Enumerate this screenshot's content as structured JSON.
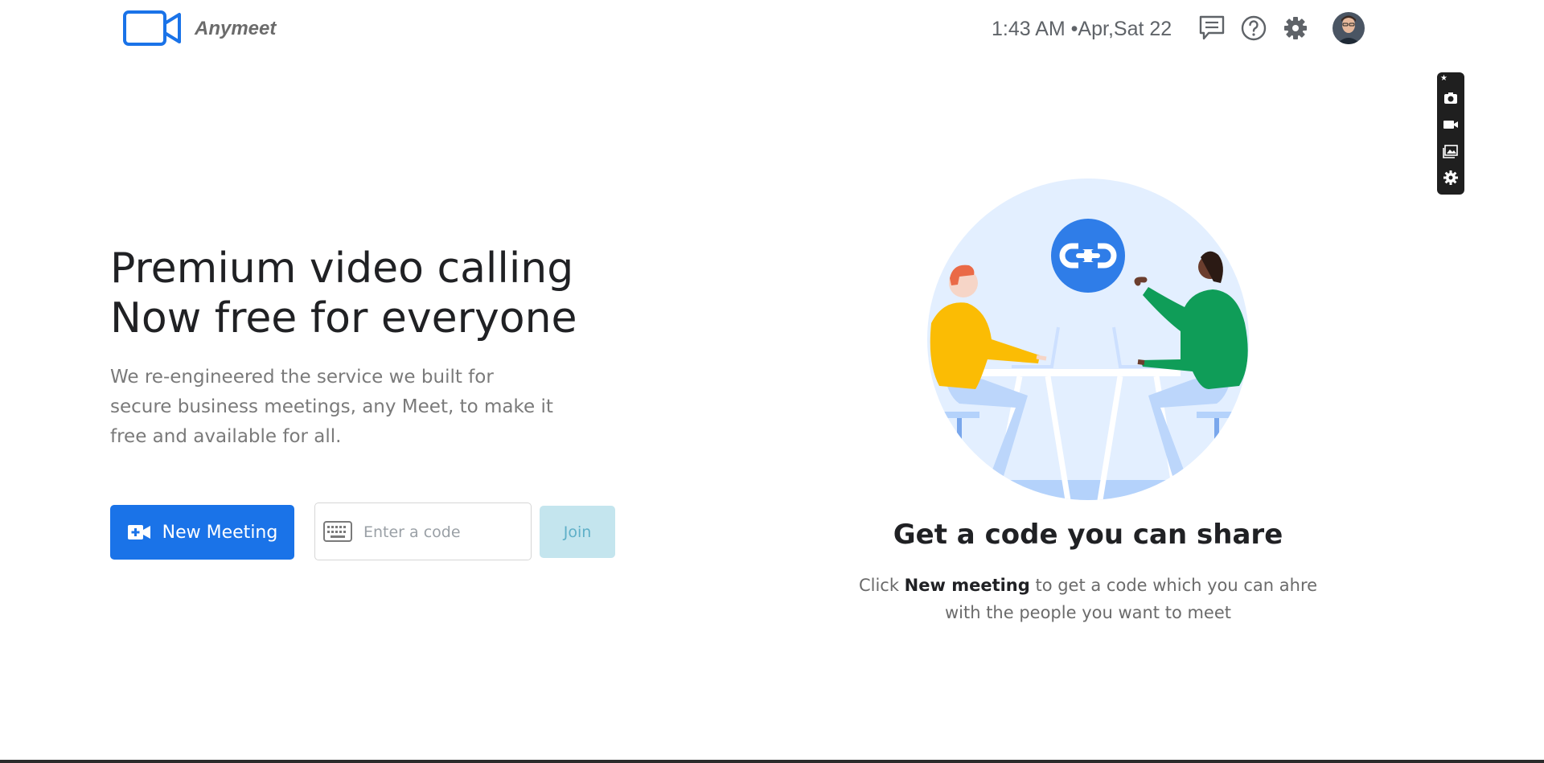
{
  "header": {
    "brand": "Anymeet",
    "datetime": "1:43 AM •Apr,Sat 22",
    "icons": [
      "feedback-icon",
      "help-icon",
      "settings-icon",
      "avatar"
    ]
  },
  "floating_toolbar": {
    "icons": [
      "pin-icon",
      "camera-icon",
      "video-icon",
      "gallery-icon",
      "settings-icon"
    ]
  },
  "hero": {
    "title_line1": "Premium video calling",
    "title_line2": "Now free for everyone",
    "description": "We re-engineered the service we built for secure business meetings, any Meet, to make it free and available for all."
  },
  "actions": {
    "new_meeting_label": "New Meeting",
    "code_placeholder": "Enter a code",
    "join_label": "Join"
  },
  "info": {
    "title": "Get a code you can share",
    "desc_prefix": "Click ",
    "desc_bold": "New meeting",
    "desc_suffix": " to get a code which you can ahre with the people you want to meet"
  },
  "colors": {
    "primary": "#1a73e8",
    "join_bg": "#c4e5ee",
    "join_text": "#5fb0c8",
    "illustration_bg": "#e3efff",
    "link_badge": "#2f7de8"
  }
}
